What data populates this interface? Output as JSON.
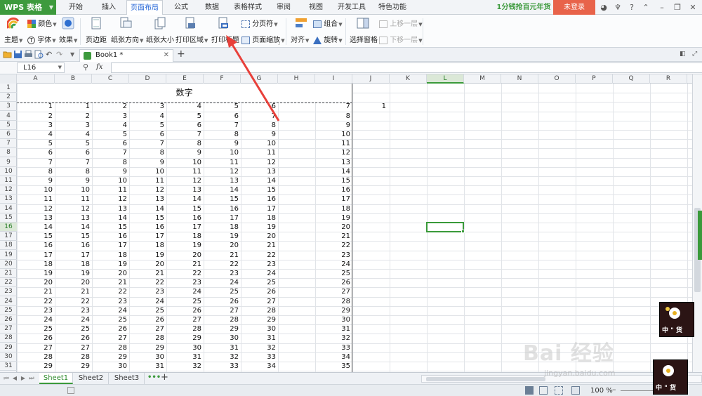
{
  "app": {
    "name": "WPS 表格"
  },
  "menu": {
    "tabs": [
      "开始",
      "插入",
      "页面布局",
      "公式",
      "数据",
      "表格样式",
      "审阅",
      "视图",
      "开发工具",
      "特色功能"
    ],
    "active_tab": "页面布局",
    "promo": "1分钱抢百元年货",
    "login": "未登录"
  },
  "ribbon": {
    "theme": "主题",
    "colors": "颜色",
    "fonts": "字体",
    "effects": "效果",
    "margins": "页边距",
    "orientation": "纸张方向",
    "size": "纸张大小",
    "print_area": "打印区域",
    "print_titles": "打印标题",
    "page_break": "分页符",
    "page_scaling": "页面缩放",
    "align": "对齐",
    "group": "组合",
    "rotate": "旋转",
    "selection_pane": "选择窗格",
    "bring_forward": "上移一层",
    "send_backward": "下移一层"
  },
  "document": {
    "tab": "Book1 *"
  },
  "formula": {
    "name_box": "L16",
    "fx": "fx",
    "value": ""
  },
  "sheet": {
    "columns": [
      "A",
      "B",
      "C",
      "D",
      "E",
      "F",
      "G",
      "H",
      "I",
      "J",
      "K",
      "L",
      "M",
      "N",
      "O",
      "P",
      "Q",
      "R"
    ],
    "active_column": "L",
    "active_row": 16,
    "title": "数字",
    "extra_value": "1",
    "rows": [
      [
        1,
        1,
        2,
        3,
        4,
        5,
        6,
        7
      ],
      [
        2,
        2,
        3,
        4,
        5,
        6,
        7,
        8
      ],
      [
        3,
        3,
        4,
        5,
        6,
        7,
        8,
        9
      ],
      [
        4,
        4,
        5,
        6,
        7,
        8,
        9,
        10
      ],
      [
        5,
        5,
        6,
        7,
        8,
        9,
        10,
        11
      ],
      [
        6,
        6,
        7,
        8,
        9,
        10,
        11,
        12
      ],
      [
        7,
        7,
        8,
        9,
        10,
        11,
        12,
        13
      ],
      [
        8,
        8,
        9,
        10,
        11,
        12,
        13,
        14
      ],
      [
        9,
        9,
        10,
        11,
        12,
        13,
        14,
        15
      ],
      [
        10,
        10,
        11,
        12,
        13,
        14,
        15,
        16
      ],
      [
        11,
        11,
        12,
        13,
        14,
        15,
        16,
        17
      ],
      [
        12,
        12,
        13,
        14,
        15,
        16,
        17,
        18
      ],
      [
        13,
        13,
        14,
        15,
        16,
        17,
        18,
        19
      ],
      [
        14,
        14,
        15,
        16,
        17,
        18,
        19,
        20
      ],
      [
        15,
        15,
        16,
        17,
        18,
        19,
        20,
        21
      ],
      [
        16,
        16,
        17,
        18,
        19,
        20,
        21,
        22
      ],
      [
        17,
        17,
        18,
        19,
        20,
        21,
        22,
        23
      ],
      [
        18,
        18,
        19,
        20,
        21,
        22,
        23,
        24
      ],
      [
        19,
        19,
        20,
        21,
        22,
        23,
        24,
        25
      ],
      [
        20,
        20,
        21,
        22,
        23,
        24,
        25,
        26
      ],
      [
        21,
        21,
        22,
        23,
        24,
        25,
        26,
        27
      ],
      [
        22,
        22,
        23,
        24,
        25,
        26,
        27,
        28
      ],
      [
        23,
        23,
        24,
        25,
        26,
        27,
        28,
        29
      ],
      [
        24,
        24,
        25,
        26,
        27,
        28,
        29,
        30
      ],
      [
        25,
        25,
        26,
        27,
        28,
        29,
        30,
        31
      ],
      [
        26,
        26,
        27,
        28,
        29,
        30,
        31,
        32
      ],
      [
        27,
        27,
        28,
        29,
        30,
        31,
        32,
        33
      ],
      [
        28,
        28,
        29,
        30,
        31,
        32,
        33,
        34
      ],
      [
        29,
        29,
        30,
        31,
        32,
        33,
        34,
        35
      ]
    ]
  },
  "sheet_tabs": {
    "items": [
      "Sheet1",
      "Sheet2",
      "Sheet3"
    ],
    "active": "Sheet1",
    "more": "•••",
    "add": "+"
  },
  "status": {
    "zoom": "100 %"
  },
  "overlay": {
    "watermark": "Bai 经验",
    "watermark_url": "jingyan.baidu.com",
    "stamp_text": "中 \" 货"
  },
  "colors": {
    "accent": "#3d9a3d",
    "menu_active": "#2a6ad8",
    "login": "#e8634a",
    "arrow": "#e8403a"
  }
}
